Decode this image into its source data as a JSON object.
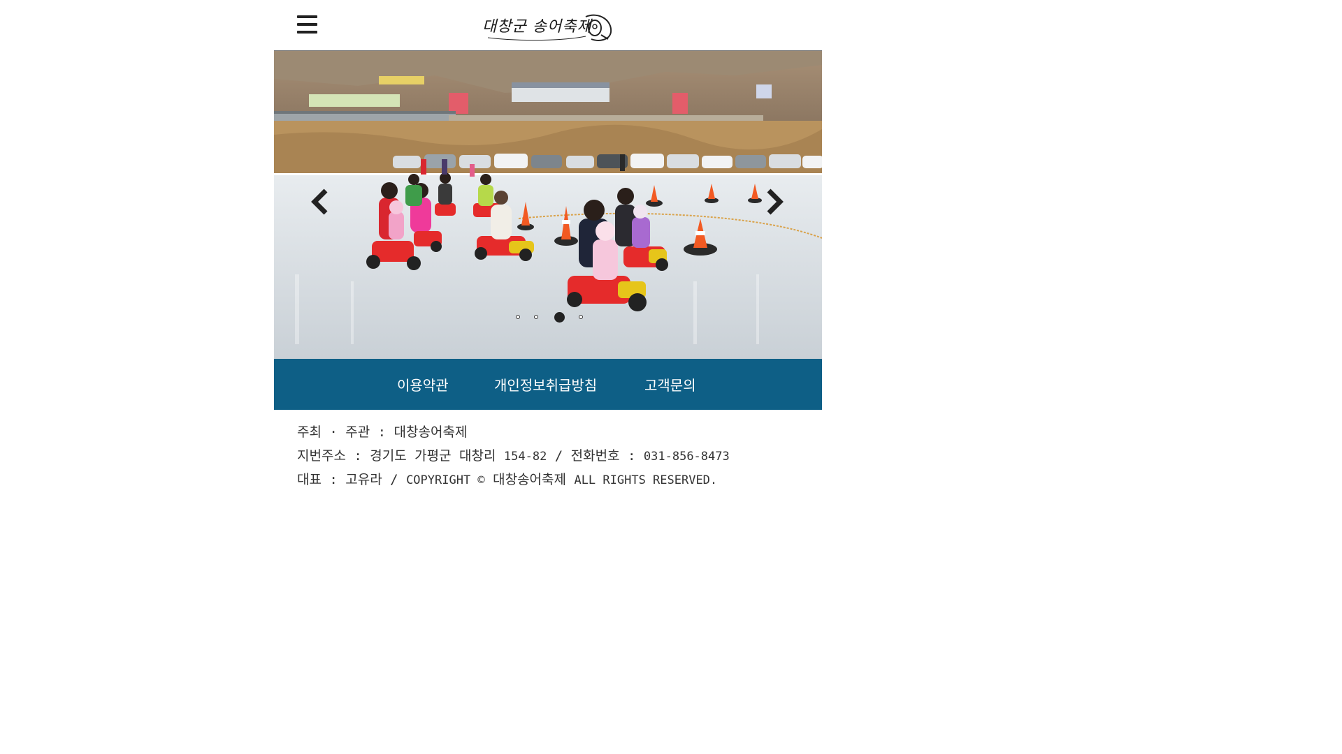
{
  "header": {
    "logo_text": "대창군 송어축제",
    "menu_icon": "hamburger-menu-icon"
  },
  "slider": {
    "prev_icon": "chevron-left-icon",
    "next_icon": "chevron-right-icon",
    "slide_count": 4,
    "active_slide": 3,
    "image_description_icon": "photo"
  },
  "footer_nav": {
    "items": [
      {
        "label": "이용약관"
      },
      {
        "label": "개인정보취급방침"
      },
      {
        "label": "고객문의"
      }
    ]
  },
  "info": {
    "host_label": "주최 · 주관 : 대창송어축제",
    "address_label": "지번주소 : 경기도 가평군 대창리",
    "address_number": "154-82",
    "phone_label": "/ 전화번호 :",
    "phone_number": "031-856-8473",
    "rep_label": "대표 : 고유라 /",
    "copyright_prefix": "COPYRIGHT ©",
    "copyright_name": "대창송어축제",
    "copyright_suffix": "ALL RIGHTS RESERVED."
  },
  "colors": {
    "nav_bg": "#0e5f86",
    "text": "#333333",
    "ice": "#dfe4e8"
  }
}
